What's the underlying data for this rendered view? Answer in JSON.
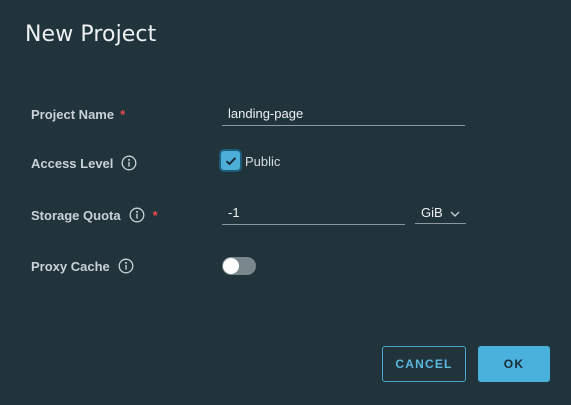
{
  "dialog": {
    "title": "New Project"
  },
  "form": {
    "project_name": {
      "label": "Project Name",
      "required_mark": "*",
      "value": "landing-page"
    },
    "access_level": {
      "label": "Access Level",
      "info_icon": "info-icon",
      "checkbox_label": "Public",
      "checked": true
    },
    "storage_quota": {
      "label": "Storage Quota",
      "info_icon": "info-icon",
      "required_mark": "*",
      "value": "-1",
      "unit": "GiB"
    },
    "proxy_cache": {
      "label": "Proxy Cache",
      "info_icon": "info-icon",
      "enabled": false
    }
  },
  "actions": {
    "cancel_label": "CANCEL",
    "ok_label": "OK"
  },
  "colors": {
    "background": "#21333b",
    "accent": "#49b1dc",
    "required": "#e84a4a"
  }
}
